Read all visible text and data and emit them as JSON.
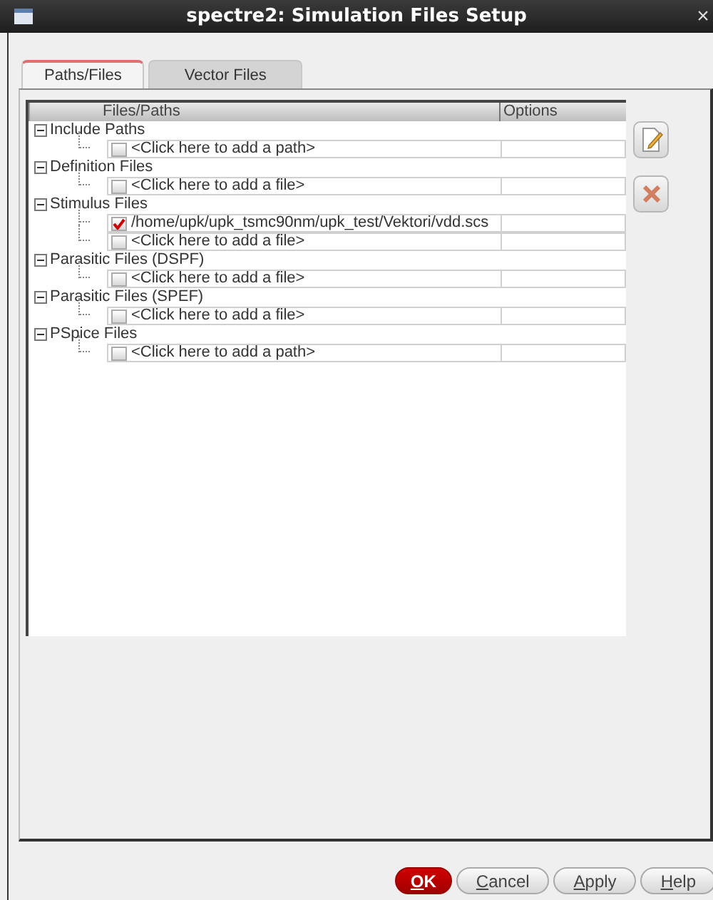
{
  "window": {
    "title": "spectre2: Simulation Files Setup",
    "close": "×"
  },
  "tabs": [
    {
      "label": "Paths/Files",
      "selected": true
    },
    {
      "label": "Vector Files",
      "selected": false
    }
  ],
  "tree": {
    "columns": [
      "Files/Paths",
      "Options"
    ],
    "groups": [
      {
        "label": "Include Paths",
        "expanded": true,
        "children": [
          {
            "text": "<Click here to add a path>",
            "checked": false
          }
        ]
      },
      {
        "label": "Definition Files",
        "expanded": true,
        "children": [
          {
            "text": "<Click here to add a file>",
            "checked": false
          }
        ]
      },
      {
        "label": "Stimulus Files",
        "expanded": true,
        "children": [
          {
            "text": "/home/upk/upk_tsmc90nm/upk_test/Vektori/vdd.scs",
            "checked": true
          },
          {
            "text": "<Click here to add a file>",
            "checked": false
          }
        ]
      },
      {
        "label": "Parasitic Files (DSPF)",
        "expanded": true,
        "children": [
          {
            "text": "<Click here to add a file>",
            "checked": false
          }
        ]
      },
      {
        "label": "Parasitic Files (SPEF)",
        "expanded": true,
        "children": [
          {
            "text": "<Click here to add a file>",
            "checked": false
          }
        ]
      },
      {
        "label": "PSpice Files",
        "expanded": true,
        "children": [
          {
            "text": "<Click here to add a path>",
            "checked": false
          }
        ]
      }
    ]
  },
  "buttons": [
    {
      "label": "OK",
      "kind": "primary"
    },
    {
      "label": "Cancel",
      "kind": "normal"
    },
    {
      "label": "Apply",
      "kind": "normal"
    },
    {
      "label": "Help",
      "kind": "normal"
    }
  ]
}
